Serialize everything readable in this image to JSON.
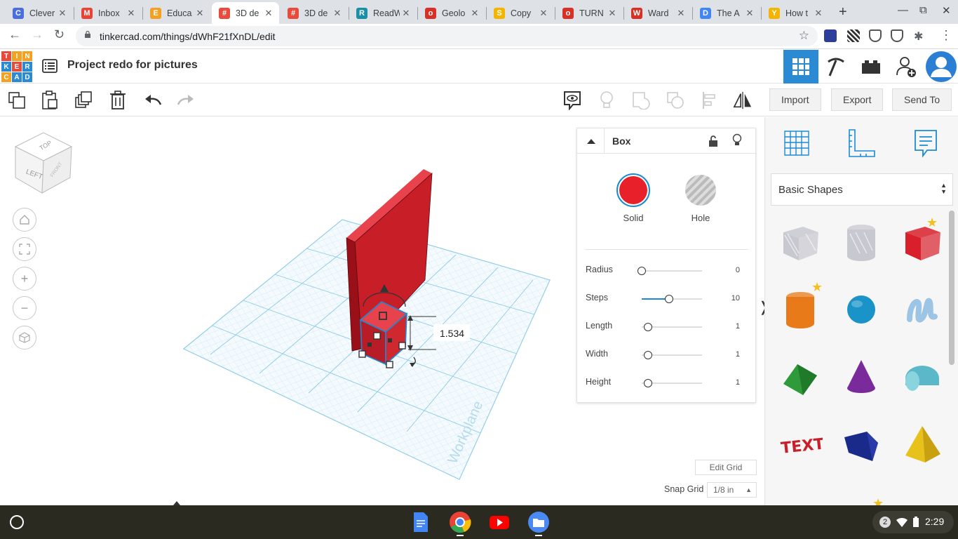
{
  "browser": {
    "tabs": [
      {
        "title": "Clever",
        "favicon": "C",
        "color": "#4a6ee0"
      },
      {
        "title": "Inbox",
        "favicon": "M",
        "color": "#ea4335"
      },
      {
        "title": "Educa",
        "favicon": "E",
        "color": "#f4a020"
      },
      {
        "title": "3D de",
        "favicon": "#",
        "color": "#e84a3c",
        "active": true
      },
      {
        "title": "3D de",
        "favicon": "#",
        "color": "#e84a3c"
      },
      {
        "title": "ReadW",
        "favicon": "R",
        "color": "#1a8fa8"
      },
      {
        "title": "Geolo",
        "favicon": "o",
        "color": "#d93025"
      },
      {
        "title": "Copy ",
        "favicon": "S",
        "color": "#f4b400"
      },
      {
        "title": "TURN",
        "favicon": "o",
        "color": "#d93025"
      },
      {
        "title": "Ward",
        "favicon": "W",
        "color": "#d93025"
      },
      {
        "title": "The A",
        "favicon": "D",
        "color": "#4285f4"
      },
      {
        "title": "How t",
        "favicon": "Y",
        "color": "#f4b400"
      }
    ],
    "url": "tinkercad.com/things/dWhF21fXnDL/edit"
  },
  "header": {
    "logo_letters": [
      "T",
      "I",
      "N",
      "K",
      "E",
      "R",
      "C",
      "A",
      "D"
    ],
    "project_title": "Project redo for pictures"
  },
  "toolbar": {
    "import_label": "Import",
    "export_label": "Export",
    "sendto_label": "Send To"
  },
  "viewcube": {
    "top": "TOP",
    "left": "LEFT",
    "front": "FRONT"
  },
  "viewport": {
    "dimension_value": "1.534",
    "workplane_label": "Workplane"
  },
  "inspector": {
    "title": "Box",
    "solid_label": "Solid",
    "hole_label": "Hole",
    "solid_color": "#e8202a",
    "properties": [
      {
        "label": "Radius",
        "value": "0",
        "fraction": 0.0
      },
      {
        "label": "Steps",
        "value": "10",
        "fraction": 0.45
      },
      {
        "label": "Length",
        "value": "1",
        "fraction": 0.1
      },
      {
        "label": "Width",
        "value": "1",
        "fraction": 0.1
      },
      {
        "label": "Height",
        "value": "1",
        "fraction": 0.1
      }
    ]
  },
  "bottom": {
    "edit_grid_label": "Edit Grid",
    "snap_grid_label": "Snap Grid",
    "snap_grid_value": "1/8 in"
  },
  "shapes_panel": {
    "category": "Basic Shapes",
    "shapes": [
      {
        "name": "box-hole",
        "color": "#c8c8d0"
      },
      {
        "name": "cylinder-hole",
        "color": "#c8c8d0"
      },
      {
        "name": "box",
        "color": "#d9202a"
      },
      {
        "name": "cylinder",
        "color": "#e87a1a"
      },
      {
        "name": "sphere",
        "color": "#1a94c8"
      },
      {
        "name": "scribble",
        "color": "#9cc4e4"
      },
      {
        "name": "roof",
        "color": "#2e9a3a"
      },
      {
        "name": "cone",
        "color": "#7a2a9a"
      },
      {
        "name": "round-roof",
        "color": "#5ab8c8"
      },
      {
        "name": "text",
        "color": "#c8202a"
      },
      {
        "name": "polygon",
        "color": "#1a2a8a"
      },
      {
        "name": "pyramid",
        "color": "#e8c21a"
      }
    ]
  },
  "taskbar": {
    "clock": "2:29",
    "notification_count": "2"
  }
}
